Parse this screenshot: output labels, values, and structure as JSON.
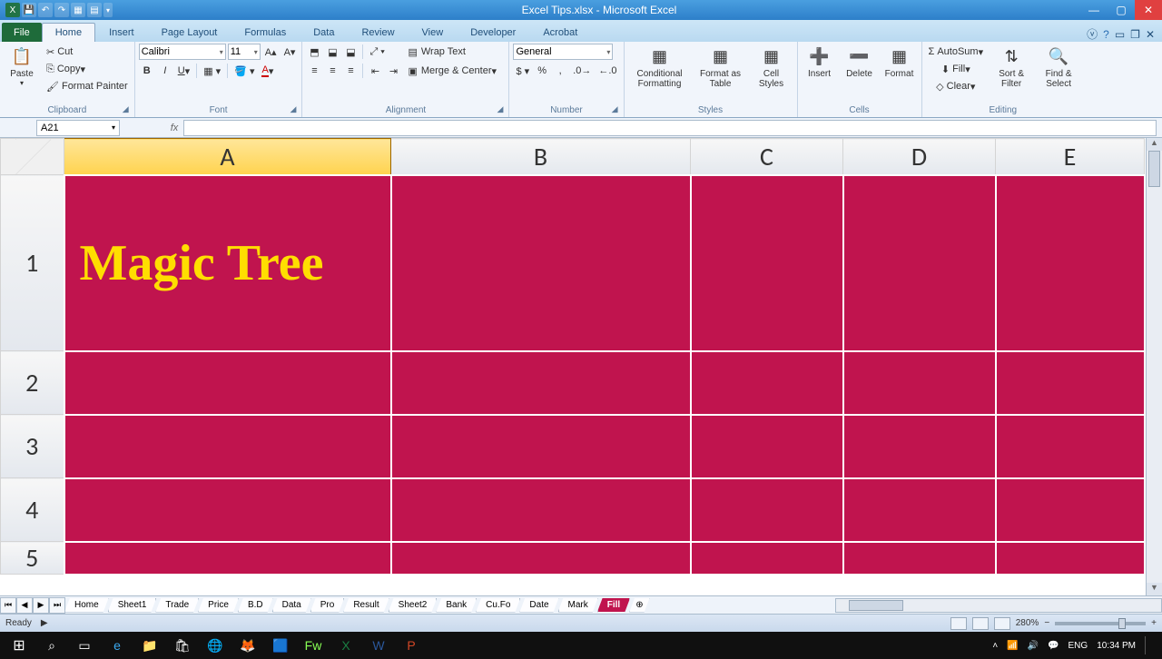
{
  "titlebar": {
    "title": "Excel Tips.xlsx - Microsoft Excel"
  },
  "tabs": {
    "file": "File",
    "items": [
      "Home",
      "Insert",
      "Page Layout",
      "Formulas",
      "Data",
      "Review",
      "View",
      "Developer",
      "Acrobat"
    ],
    "active": "Home"
  },
  "ribbon": {
    "clipboard": {
      "paste": "Paste",
      "cut": "Cut",
      "copy": "Copy",
      "painter": "Format Painter",
      "label": "Clipboard"
    },
    "font": {
      "name": "Calibri",
      "size": "11",
      "label": "Font"
    },
    "alignment": {
      "wrap": "Wrap Text",
      "merge": "Merge & Center",
      "label": "Alignment"
    },
    "number": {
      "format": "General",
      "label": "Number"
    },
    "styles": {
      "cond": "Conditional Formatting",
      "table": "Format as Table",
      "cell": "Cell Styles",
      "label": "Styles"
    },
    "cells": {
      "insert": "Insert",
      "delete": "Delete",
      "format": "Format",
      "label": "Cells"
    },
    "editing": {
      "autosum": "AutoSum",
      "fill": "Fill",
      "clear": "Clear",
      "sort": "Sort & Filter",
      "find": "Find & Select",
      "label": "Editing"
    }
  },
  "namebox": "A21",
  "columns": [
    "A",
    "B",
    "C",
    "D",
    "E"
  ],
  "rows": [
    "1",
    "2",
    "3",
    "4",
    "5"
  ],
  "cells": {
    "A1": "Magic Tree"
  },
  "sheet_tabs": [
    "Home",
    "Sheet1",
    "Trade",
    "Price",
    "B.D",
    "Data",
    "Pro",
    "Result",
    "Sheet2",
    "Bank",
    "Cu.Fo",
    "Date",
    "Mark",
    "Fill"
  ],
  "active_sheet": "Fill",
  "status": {
    "ready": "Ready",
    "zoom": "280%"
  },
  "taskbar": {
    "lang": "ENG",
    "time": "10:34 PM"
  }
}
